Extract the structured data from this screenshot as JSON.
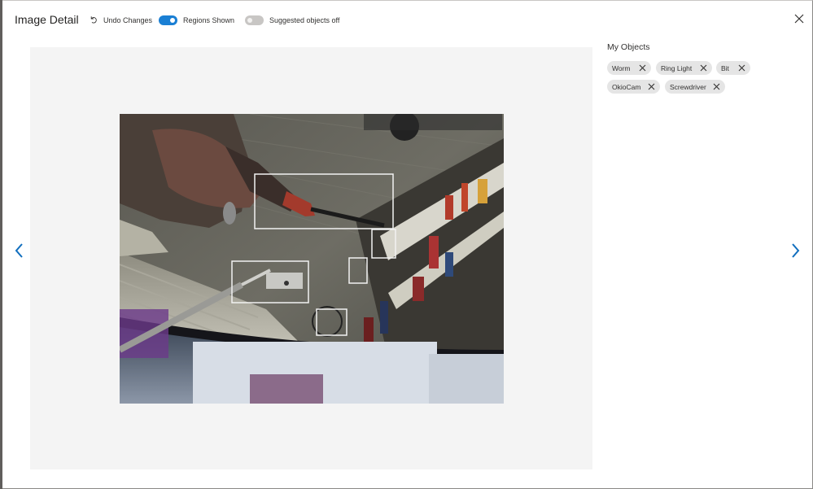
{
  "header": {
    "title": "Image Detail",
    "undo_label": "Undo Changes",
    "regions_toggle": {
      "label": "Regions Shown",
      "state": "on"
    },
    "suggested_toggle": {
      "label": "Suggested objects off",
      "state": "off"
    }
  },
  "panel": {
    "title": "My Objects",
    "chips": [
      {
        "label": "Worm"
      },
      {
        "label": "Ring Light"
      },
      {
        "label": "Bit"
      },
      {
        "label": "OkioCam"
      },
      {
        "label": "Screwdriver"
      }
    ]
  },
  "colors": {
    "accent": "#1a7fd4",
    "nav_arrow": "#106ebe",
    "chip_bg": "#e5e5e5",
    "viewer_bg": "#f4f4f4"
  },
  "icons": {
    "undo": "undo-icon",
    "close": "close-icon",
    "prev": "chevron-left-icon",
    "next": "chevron-right-icon",
    "chip_remove": "dismiss-icon"
  }
}
